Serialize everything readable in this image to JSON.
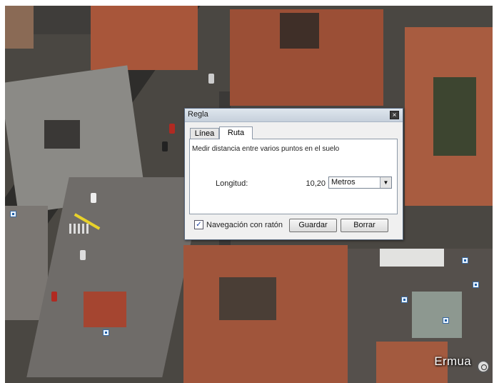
{
  "map": {
    "place_label": "Ermua",
    "compass_icon": "compass-icon",
    "pin_icon": "photo-pin-icon"
  },
  "dialog": {
    "title": "Regla",
    "close_label": "×",
    "tabs": [
      {
        "label": "Línea"
      },
      {
        "label": "Ruta"
      }
    ],
    "instruction": "Medir distancia entre varios puntos en el suelo",
    "length_label": "Longitud:",
    "length_value": "10,20",
    "unit": {
      "selected": "Metros",
      "arrow_label": "▼"
    },
    "mouse_navigation": {
      "label": "Navegación con ratón",
      "checked": true,
      "mark": "✓"
    },
    "save_label": "Guardar",
    "clear_label": "Borrar"
  }
}
